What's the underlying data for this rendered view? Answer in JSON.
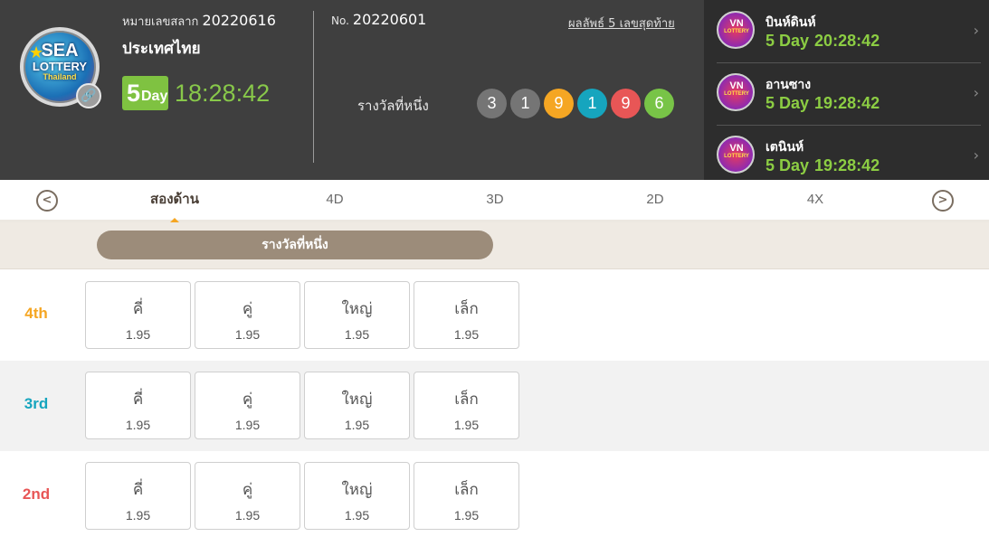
{
  "main_lottery": {
    "logo_text": [
      "SEA",
      "LOTTERY",
      "Thailand"
    ],
    "lot_label": "หมายเลขสลาก",
    "lot_number": "20220616",
    "country": "ประเทศไทย",
    "day_badge_number": "5",
    "day_badge_text": "Day",
    "countdown": "18:28:42"
  },
  "last_result": {
    "no_label": "No.",
    "draw_number": "20220601",
    "results_link": "ผลลัพธ์ 5 เลขสุดท้าย",
    "prize_label": "รางวัลที่หนึ่ง",
    "balls": [
      {
        "value": "3",
        "color": "#757575"
      },
      {
        "value": "1",
        "color": "#757575"
      },
      {
        "value": "9",
        "color": "#f5a623"
      },
      {
        "value": "1",
        "color": "#16a5be"
      },
      {
        "value": "9",
        "color": "#e85656"
      },
      {
        "value": "6",
        "color": "#78c447"
      }
    ]
  },
  "side_lotteries": [
    {
      "logo_text": "VN",
      "logo_sub": "LOTTERY",
      "name": "บินห์ดินห์",
      "day": "5 Day",
      "time": "20:28:42"
    },
    {
      "logo_text": "VN",
      "logo_sub": "LOTTERY",
      "name": "อานซาง",
      "day": "5 Day",
      "time": "19:28:42"
    },
    {
      "logo_text": "VN",
      "logo_sub": "LOTTERY",
      "name": "เตนินห์",
      "day": "5 Day",
      "time": "19:28:42"
    }
  ],
  "tabs": {
    "prev_icon": "chevron-left-circle-icon",
    "next_icon": "chevron-right-circle-icon",
    "items": [
      "สองด้าน",
      "4D",
      "3D",
      "2D",
      "4X"
    ],
    "active_index": 0
  },
  "subbar": {
    "pill_label": "รางวัลที่หนึ่ง"
  },
  "bet_rows": [
    {
      "label": "4th",
      "color": "#f5a623",
      "cells": [
        {
          "name": "คี่",
          "odds": "1.95"
        },
        {
          "name": "คู่",
          "odds": "1.95"
        },
        {
          "name": "ใหญ่",
          "odds": "1.95"
        },
        {
          "name": "เล็ก",
          "odds": "1.95"
        }
      ]
    },
    {
      "label": "3rd",
      "color": "#16a5be",
      "cells": [
        {
          "name": "คี่",
          "odds": "1.95"
        },
        {
          "name": "คู่",
          "odds": "1.95"
        },
        {
          "name": "ใหญ่",
          "odds": "1.95"
        },
        {
          "name": "เล็ก",
          "odds": "1.95"
        }
      ]
    },
    {
      "label": "2nd",
      "color": "#e85656",
      "cells": [
        {
          "name": "คี่",
          "odds": "1.95"
        },
        {
          "name": "คู่",
          "odds": "1.95"
        },
        {
          "name": "ใหญ่",
          "odds": "1.95"
        },
        {
          "name": "เล็ก",
          "odds": "1.95"
        }
      ]
    }
  ]
}
